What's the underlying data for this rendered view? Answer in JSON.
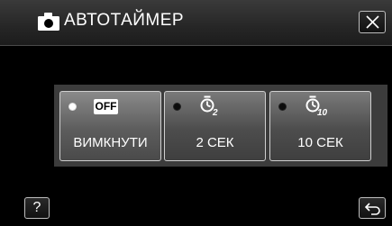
{
  "header": {
    "icon": "camera-icon",
    "title": "АВТОТАЙМЕР",
    "close_icon": "close-icon"
  },
  "options": [
    {
      "badge": "OFF",
      "label": "ВИМКНУТИ",
      "selected": true
    },
    {
      "icon": "timer-2-icon",
      "label": "2 СЕК",
      "selected": false
    },
    {
      "icon": "timer-10-icon",
      "label": "10 СЕК",
      "selected": false
    }
  ],
  "footer": {
    "help_label": "?",
    "back_icon": "return-icon"
  }
}
